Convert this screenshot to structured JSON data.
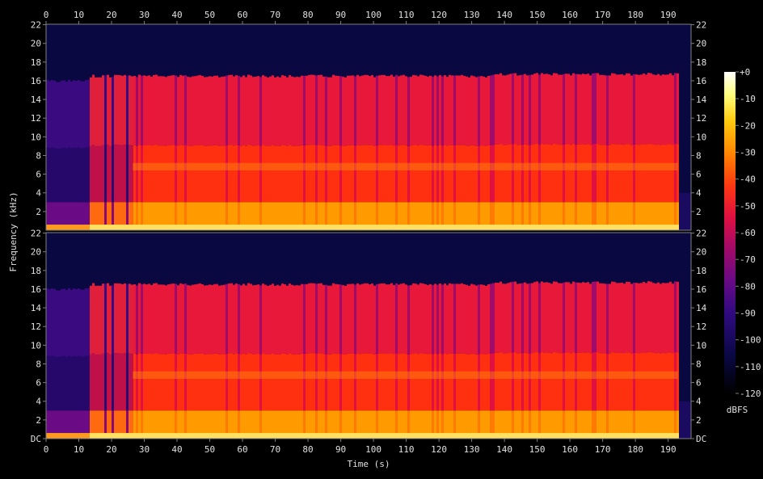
{
  "chart_data": {
    "type": "heatmap",
    "xlabel": "Time (s)",
    "ylabel": "Frequency (kHz)",
    "x_ticks": [
      "0",
      "10",
      "20",
      "30",
      "40",
      "50",
      "60",
      "70",
      "80",
      "90",
      "100",
      "110",
      "120",
      "130",
      "140",
      "150",
      "160",
      "170",
      "180",
      "190"
    ],
    "x_tick_values": [
      0,
      10,
      20,
      30,
      40,
      50,
      60,
      70,
      80,
      90,
      100,
      110,
      120,
      130,
      140,
      150,
      160,
      170,
      180,
      190
    ],
    "xlim": [
      0,
      197
    ],
    "ylim_khz": [
      0,
      22.05
    ],
    "y_ticks_upper": [
      "22",
      "20",
      "18",
      "16",
      "14",
      "12",
      "10",
      "8",
      "6",
      "4",
      "2"
    ],
    "y_ticks_lower": [
      "22",
      "20",
      "18",
      "16",
      "14",
      "12",
      "10",
      "8",
      "6",
      "4",
      "2",
      "DC"
    ],
    "y_tick_values": [
      22,
      20,
      18,
      16,
      14,
      12,
      10,
      8,
      6,
      4,
      2,
      0
    ],
    "channels": 2,
    "colorbar": {
      "label": "dBFS",
      "range": [
        -120,
        0
      ],
      "ticks": [
        "+0",
        "-10",
        "-20",
        "-30",
        "-40",
        "-50",
        "-60",
        "-70",
        "-80",
        "-90",
        "-100",
        "-110",
        "-120"
      ],
      "tick_values": [
        0,
        -10,
        -20,
        -30,
        -40,
        -50,
        -60,
        -70,
        -80,
        -90,
        -100,
        -110,
        -120
      ]
    },
    "segments": [
      {
        "start": 0,
        "end": 13,
        "cutoff_khz": 16,
        "level_db": -100
      },
      {
        "start": 13,
        "end": 26.5,
        "cutoff_khz": 16.5,
        "level_db": -70
      },
      {
        "start": 26.5,
        "end": 135,
        "cutoff_khz": 16.5,
        "level_db": -55
      },
      {
        "start": 135,
        "end": 193,
        "cutoff_khz": 16.7,
        "level_db": -52
      }
    ],
    "colors": {
      "background": "#000000",
      "noise_floor": "#0a0840",
      "text": "#e0e0e0",
      "frame": "#808080"
    }
  }
}
